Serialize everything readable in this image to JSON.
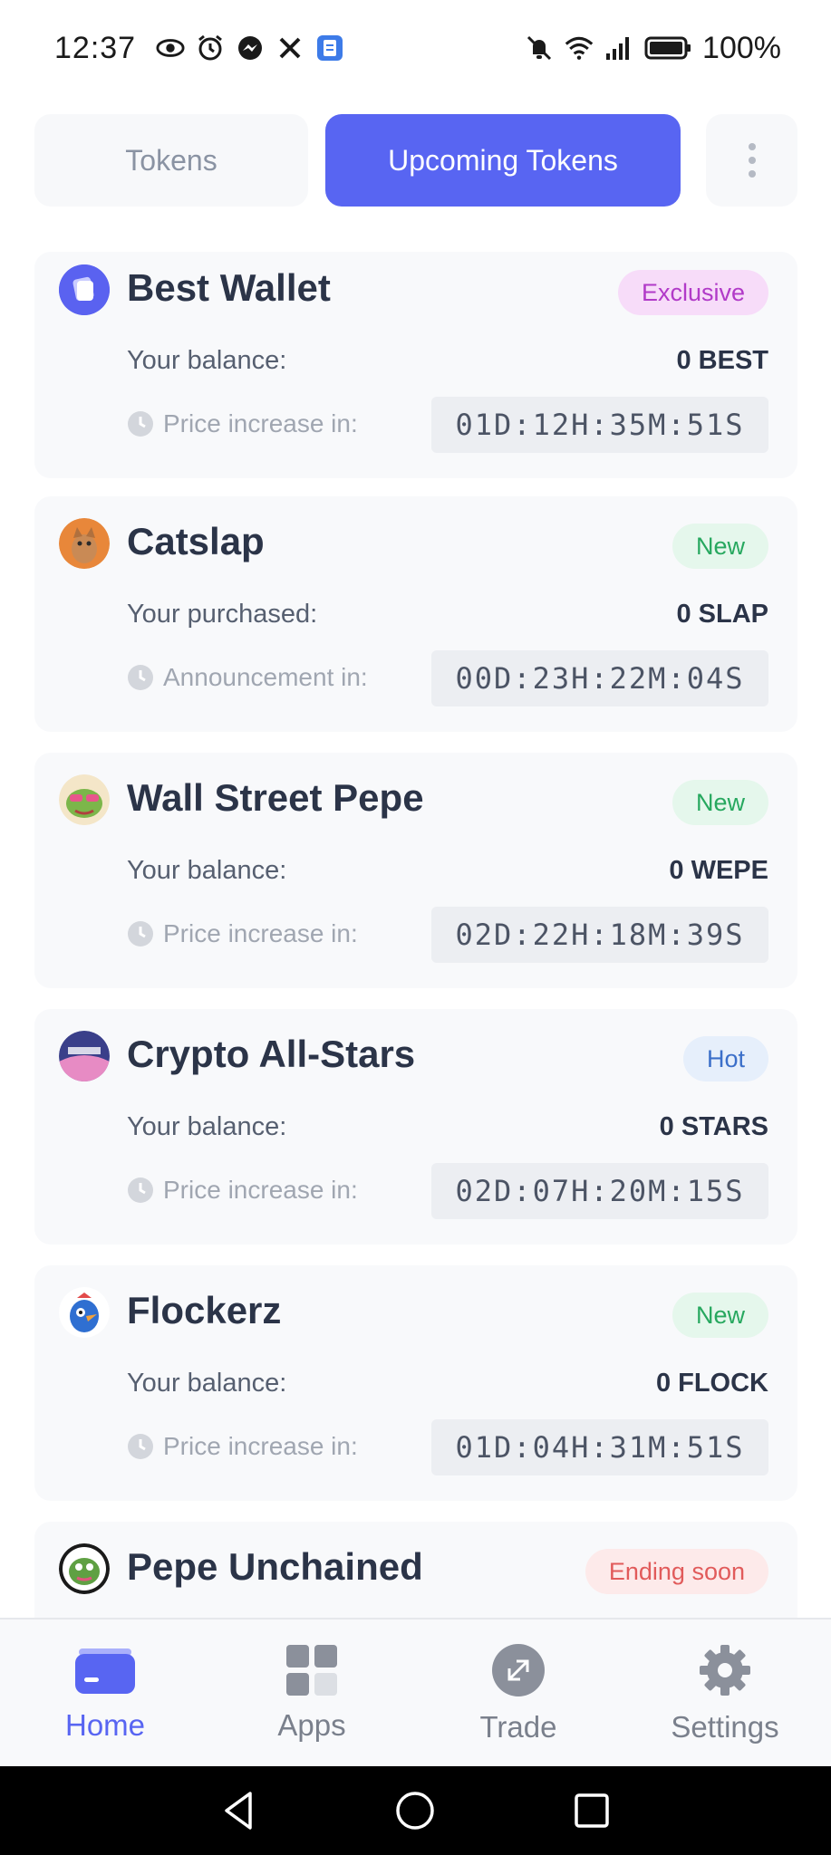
{
  "status_bar": {
    "time": "12:37",
    "battery": "100%",
    "left_icons": [
      "eye-icon",
      "alarm-icon",
      "messenger-icon",
      "x-icon",
      "notes-app-icon"
    ],
    "right_icons": [
      "bell-off-icon",
      "wifi-icon",
      "signal-icon",
      "battery-icon"
    ]
  },
  "tabs": {
    "tokens": "Tokens",
    "upcoming": "Upcoming Tokens",
    "active": "upcoming"
  },
  "tokens": [
    {
      "name": "Best Wallet",
      "badge": "Exclusive",
      "row_label": "Your balance:",
      "row_value": "0 BEST",
      "timer_label": "Price increase in:",
      "timer": "01D:12H:35M:51S"
    },
    {
      "name": "Catslap",
      "badge": "New",
      "row_label": "Your purchased:",
      "row_value": "0 SLAP",
      "timer_label": "Announcement in:",
      "timer": "00D:23H:22M:04S"
    },
    {
      "name": "Wall Street Pepe",
      "badge": "New",
      "row_label": "Your balance:",
      "row_value": "0 WEPE",
      "timer_label": "Price increase in:",
      "timer": "02D:22H:18M:39S"
    },
    {
      "name": "Crypto All-Stars",
      "badge": "Hot",
      "row_label": "Your balance:",
      "row_value": "0 STARS",
      "timer_label": "Price increase in:",
      "timer": "02D:07H:20M:15S"
    },
    {
      "name": "Flockerz",
      "badge": "New",
      "row_label": "Your balance:",
      "row_value": "0 FLOCK",
      "timer_label": "Price increase in:",
      "timer": "01D:04H:31M:51S"
    },
    {
      "name": "Pepe Unchained",
      "badge": "Ending soon"
    }
  ],
  "bottom_nav": {
    "home": "Home",
    "apps": "Apps",
    "trade": "Trade",
    "settings": "Settings",
    "active": "home"
  },
  "colors": {
    "accent": "#5865f2",
    "card_bg": "#f8f9fb",
    "exclusive": "#b13ac8",
    "new": "#27a85f",
    "hot": "#3b6fc9",
    "ending": "#e15b5b"
  }
}
